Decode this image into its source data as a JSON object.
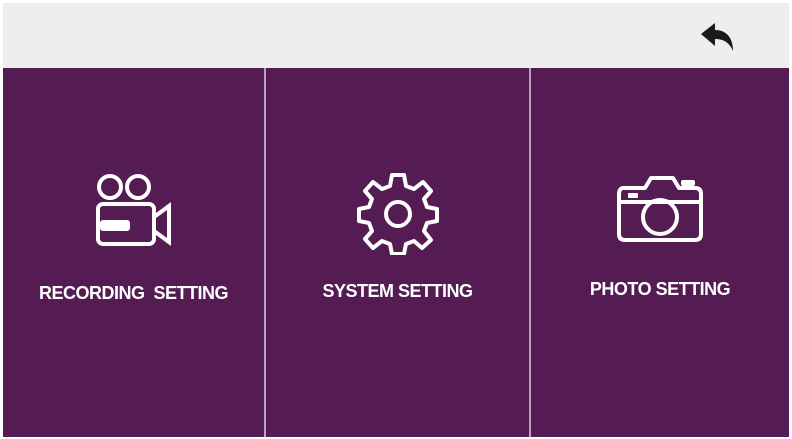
{
  "header": {
    "back_icon": "back-arrow-icon"
  },
  "menu": {
    "items": [
      {
        "label": "RECORDING  SETTING",
        "icon": "video-camera-icon"
      },
      {
        "label": "SYSTEM SETTING",
        "icon": "gear-icon"
      },
      {
        "label": "PHOTO SETTING",
        "icon": "camera-icon"
      }
    ]
  },
  "colors": {
    "panel_background": "#541c53",
    "divider": "#b9a4b9",
    "top_bar": "#eeeeee",
    "icon_color": "#ffffff",
    "back_icon_color": "#1a1a1a"
  }
}
